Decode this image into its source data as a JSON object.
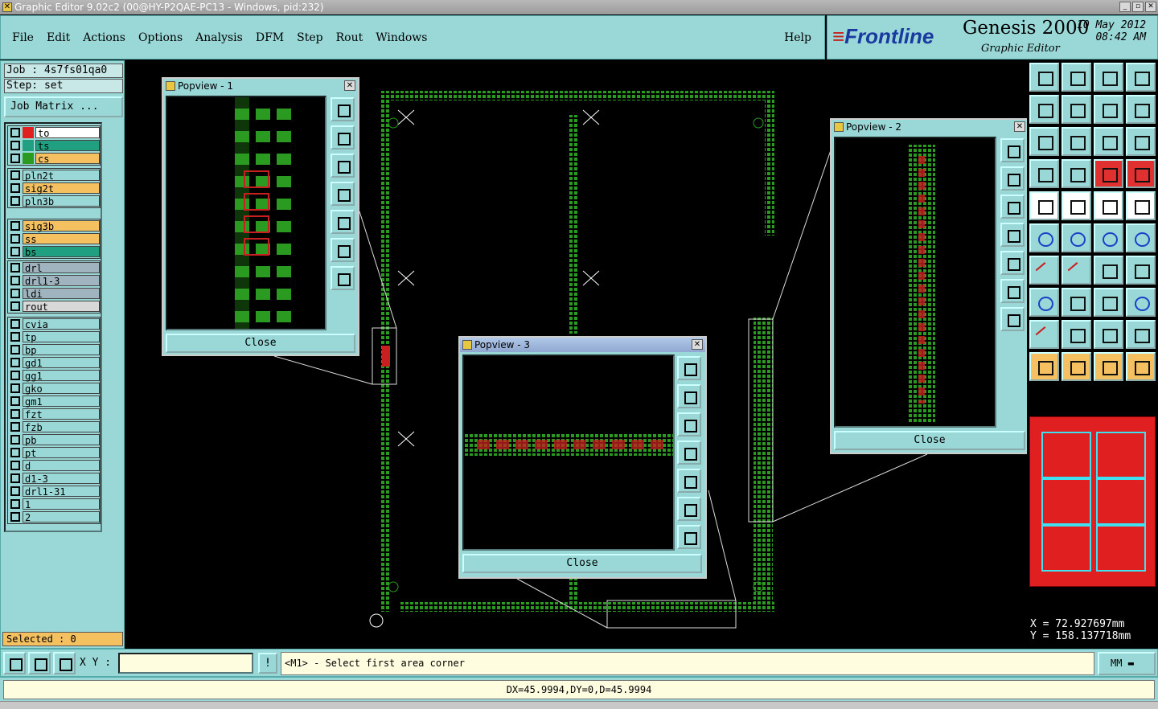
{
  "window": {
    "title": "Graphic Editor 9.02c2 (00@HY-P2QAE-PC13 - Windows, pid:232)"
  },
  "menu": {
    "items": [
      "File",
      "Edit",
      "Actions",
      "Options",
      "Analysis",
      "DFM",
      "Step",
      "Rout",
      "Windows"
    ],
    "help": "Help"
  },
  "brand": {
    "logo": "Frontline",
    "product": "Genesis 2000",
    "subtitle": "Graphic Editor",
    "date": "10 May 2012",
    "time": "08:42 AM"
  },
  "job": {
    "job_label": "Job : 4s7fs01qa0",
    "step_label": "Step: set",
    "matrix_button": "Job Matrix ..."
  },
  "layers": {
    "group1": [
      {
        "name": "to",
        "color": "#ffffff",
        "swatch": "#e02020"
      },
      {
        "name": "ts",
        "color": "#20a080",
        "swatch": "#20a080"
      },
      {
        "name": "cs",
        "color": "#f5c060",
        "swatch": "#2a9a20"
      }
    ],
    "group2": [
      {
        "name": "pln2t",
        "color": "#9ad8d8"
      },
      {
        "name": "sig2t",
        "color": "#f5c060"
      },
      {
        "name": "pln3b",
        "color": "#9ad8d8"
      }
    ],
    "group3": [
      {
        "name": "sig3b",
        "color": "#f5c060"
      },
      {
        "name": "ss",
        "color": "#f5c060"
      },
      {
        "name": "bs",
        "color": "#20a080"
      }
    ],
    "group4": [
      {
        "name": "drl",
        "color": "#a0b4c0"
      },
      {
        "name": "drl1-3",
        "color": "#a0b4c0"
      },
      {
        "name": "ldi",
        "color": "#a0b4c0"
      },
      {
        "name": "rout",
        "color": "#d8d8d8"
      }
    ],
    "group5": [
      {
        "name": "cvia"
      },
      {
        "name": "tp"
      },
      {
        "name": "bp"
      },
      {
        "name": "gd1"
      },
      {
        "name": "gg1"
      },
      {
        "name": "gko"
      },
      {
        "name": "gm1"
      },
      {
        "name": "fzt"
      },
      {
        "name": "fzb"
      },
      {
        "name": "pb"
      },
      {
        "name": "pt"
      },
      {
        "name": "d"
      },
      {
        "name": "d1-3"
      },
      {
        "name": "drl1-31"
      },
      {
        "name": "1"
      },
      {
        "name": "2"
      }
    ]
  },
  "selected": "Selected : 0",
  "popviews": [
    {
      "title": "Popview - 1",
      "close": "Close"
    },
    {
      "title": "Popview - 2",
      "close": "Close"
    },
    {
      "title": "Popview - 3",
      "close": "Close"
    }
  ],
  "coords": {
    "x": "X  =  72.927697mm",
    "y": "Y  = 158.137718mm"
  },
  "bottom": {
    "xy_label": "X Y :",
    "xy_value": "",
    "prompt": "<M1> - Select first area corner",
    "units": "MM",
    "excl": "!"
  },
  "measure": "DX=45.9994,DY=0,D=45.9994",
  "colors": {
    "panel": "#9ad8d8",
    "board_green": "#2a9a20",
    "text_red": "#c82020",
    "thumb_red": "#e02020"
  }
}
